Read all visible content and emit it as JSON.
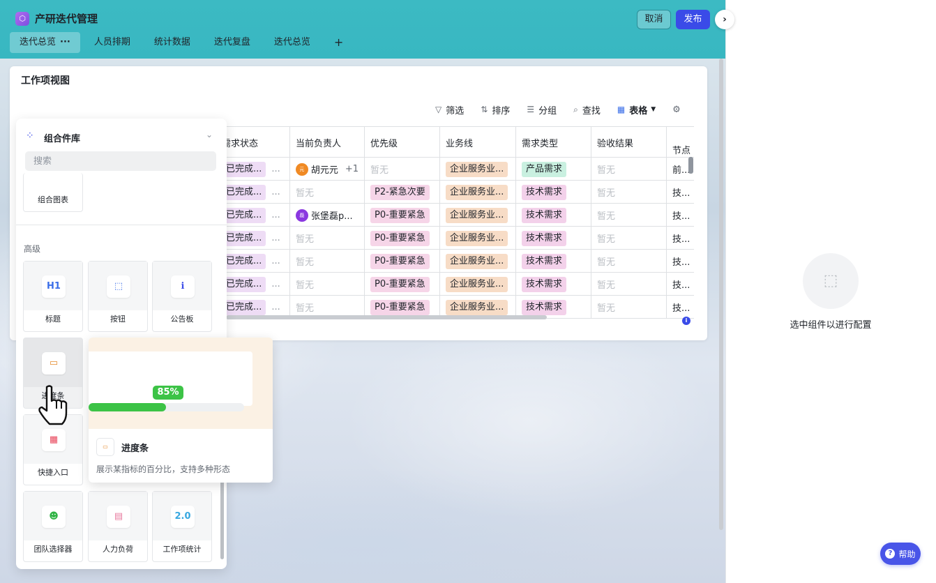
{
  "app": {
    "title": "产研迭代管理",
    "logo_glyph": "⬡"
  },
  "header": {
    "cancel_label": "取消",
    "publish_label": "发布",
    "expand_glyph": "›"
  },
  "tabs": [
    {
      "label": "迭代总览",
      "more": "···",
      "active": true
    },
    {
      "label": "人员排期"
    },
    {
      "label": "统计数据"
    },
    {
      "label": "迭代复盘"
    },
    {
      "label": "迭代总览"
    }
  ],
  "tab_add": "+",
  "card": {
    "title": "工作项视图"
  },
  "toolbar": {
    "filter": "筛选",
    "sort": "排序",
    "group": "分组",
    "find": "查找",
    "view": "表格"
  },
  "table": {
    "headers": [
      "需求状态",
      "当前负责人",
      "优先级",
      "业务线",
      "需求类型",
      "验收结果",
      "节点"
    ],
    "rows": [
      {
        "status": "已完成...",
        "owner": "胡元元",
        "owner_avatar": "元",
        "owner_extra": "+1",
        "priority": "暂无",
        "biz": "企业服务业...",
        "type": "产品需求",
        "accept": "暂无",
        "node": "前..."
      },
      {
        "status": "已完成...",
        "owner": "暂无",
        "priority": "P2-紧急次要",
        "biz": "企业服务业...",
        "type": "技术需求",
        "accept": "暂无",
        "node": "技..."
      },
      {
        "status": "已完成...",
        "owner": "张堡磊p...",
        "owner_avatar": "磊",
        "priority": "P0-重要紧急",
        "biz": "企业服务业...",
        "type": "技术需求",
        "accept": "暂无",
        "node": "技..."
      },
      {
        "status": "已完成...",
        "owner": "暂无",
        "priority": "P0-重要紧急",
        "biz": "企业服务业...",
        "type": "技术需求",
        "accept": "暂无",
        "node": "技..."
      },
      {
        "status": "已完成...",
        "owner": "暂无",
        "priority": "P0-重要紧急",
        "biz": "企业服务业...",
        "type": "技术需求",
        "accept": "暂无",
        "node": "技..."
      },
      {
        "status": "已完成...",
        "owner": "暂无",
        "priority": "P0-重要紧急",
        "biz": "企业服务业...",
        "type": "技术需求",
        "accept": "暂无",
        "node": "技..."
      },
      {
        "status": "已完成...",
        "owner": "暂无",
        "priority": "P0-重要紧急",
        "biz": "企业服务业...",
        "type": "技术需求",
        "accept": "暂无",
        "node": "技..."
      }
    ],
    "more_glyph": "..."
  },
  "library": {
    "title": "组合件库",
    "search_placeholder": "搜索",
    "combo_label": "组合图表",
    "section_advanced": "高级",
    "items": [
      {
        "label": "标题",
        "icon": "heading-icon",
        "glyph": "H1",
        "color": "#3a6ee8"
      },
      {
        "label": "按钮",
        "icon": "button-icon",
        "glyph": "⬚",
        "color": "#3a6ee8"
      },
      {
        "label": "公告板",
        "icon": "notice-icon",
        "glyph": "ℹ",
        "color": "#3a4be8"
      },
      {
        "label": "进度条",
        "icon": "progress-icon",
        "glyph": "▭",
        "color": "#e58a2c"
      },
      {
        "label": "快捷入口",
        "icon": "shortcut-icon",
        "glyph": "▦",
        "color": "#e8455a"
      },
      {
        "label": "团队选择器",
        "icon": "team-icon",
        "glyph": "☻",
        "color": "#2fb344"
      },
      {
        "label": "人力负荷",
        "icon": "workload-icon",
        "glyph": "▤",
        "color": "#e87ca0"
      },
      {
        "label": "工作项统计",
        "icon": "stats-icon",
        "glyph": "2.0",
        "color": "#38a8e0"
      }
    ]
  },
  "preview": {
    "percent_label": "85%",
    "percent": 0.85,
    "name": "进度条",
    "desc": "展示某指标的百分比，支持多种形态",
    "accent": "#3cc346"
  },
  "config": {
    "hint": "选中组件以进行配置",
    "help_label": "帮助",
    "help_glyph": "?"
  }
}
